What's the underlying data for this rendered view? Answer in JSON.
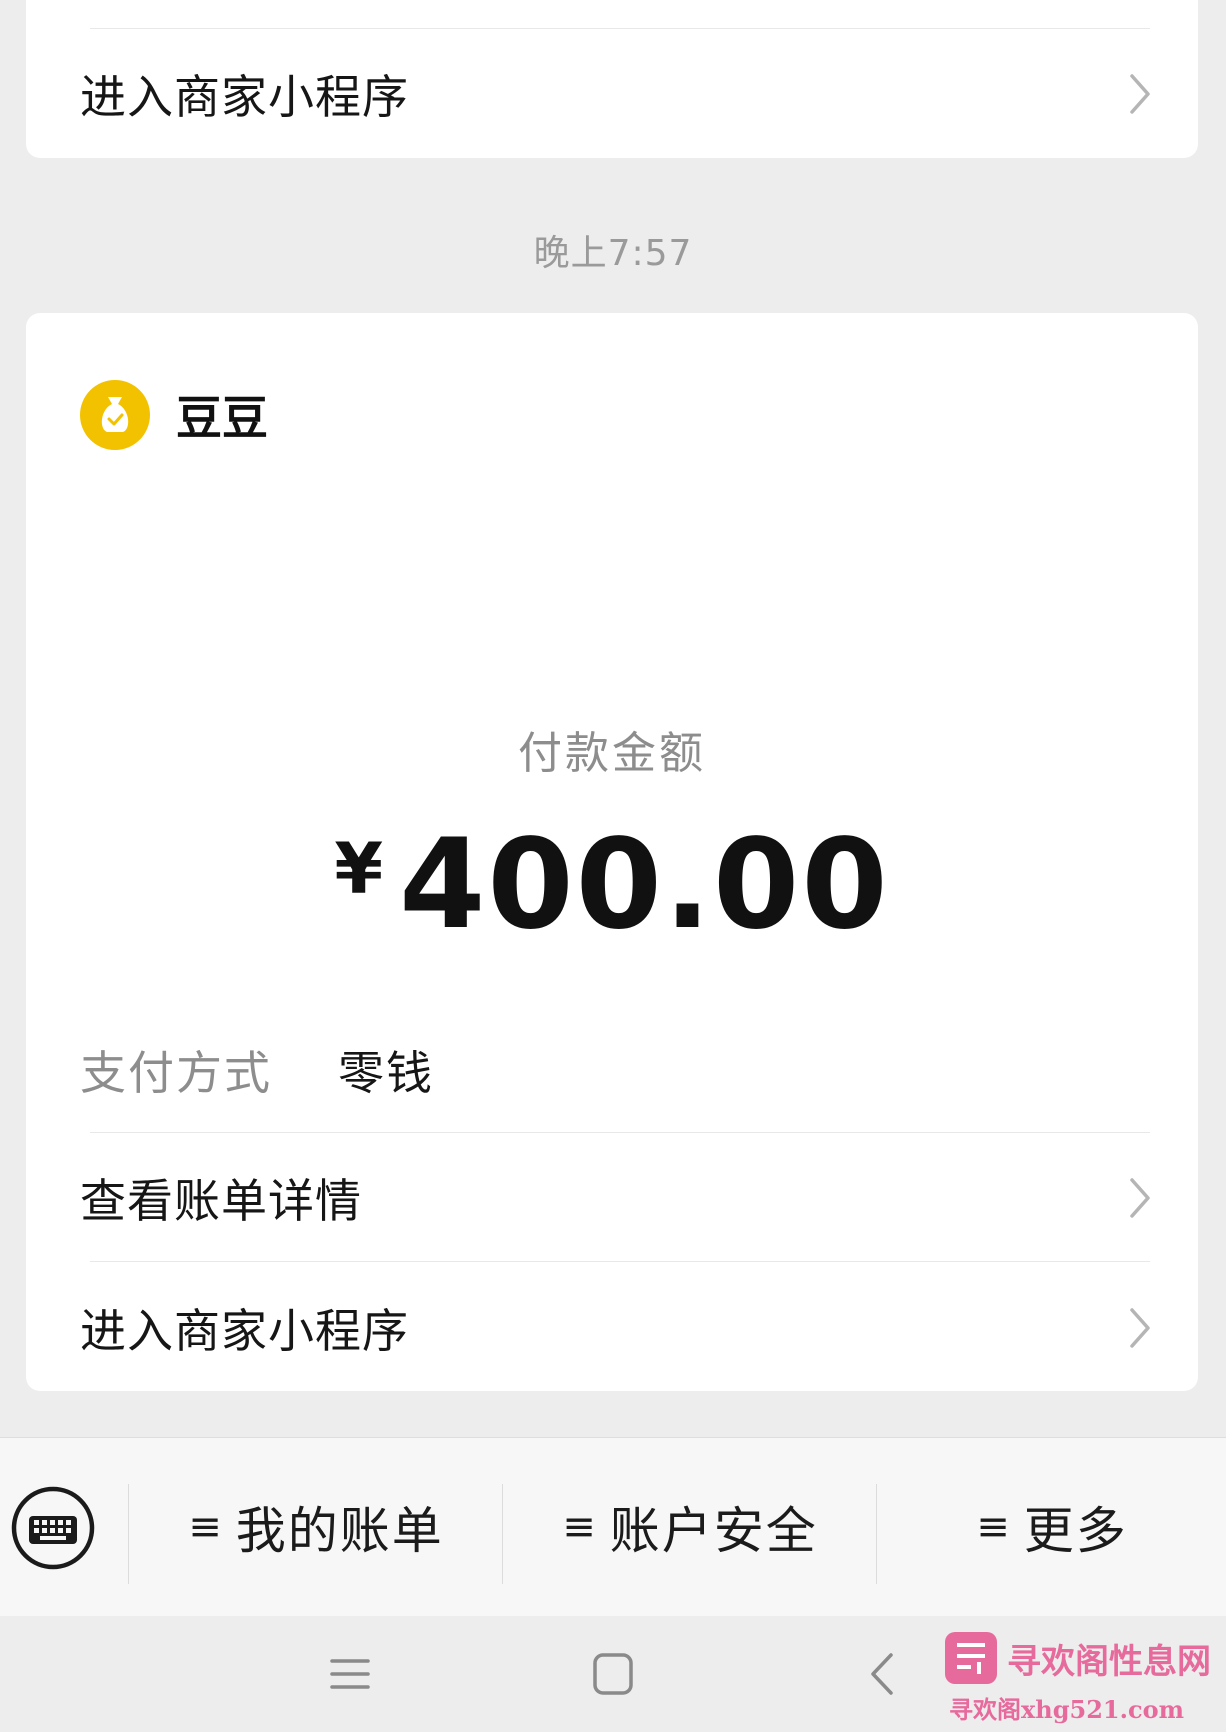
{
  "previous_message": {
    "enter_mini_program_label": "进入商家小程序"
  },
  "timestamp": "晚上7:57",
  "payment_card": {
    "merchant_name": "豆豆",
    "amount_label": "付款金额",
    "currency_symbol": "¥",
    "amount": "400.00",
    "payment_method_label": "支付方式",
    "payment_method_value": "零钱",
    "view_bill_details_label": "查看账单详情",
    "enter_mini_program_label": "进入商家小程序"
  },
  "bottom_menu": {
    "items": [
      {
        "icon": "menu-lines-icon",
        "label": "我的账单"
      },
      {
        "icon": "menu-lines-icon",
        "label": "账户安全"
      },
      {
        "icon": "menu-lines-icon",
        "label": "更多"
      }
    ],
    "menu_glyph": "≡"
  },
  "watermark": {
    "text": "寻欢阁性息网",
    "url": "寻欢阁xhg521.com"
  },
  "colors": {
    "background": "#ededed",
    "card": "#ffffff",
    "merchant_avatar": "#f2c200",
    "secondary_text": "#8d8d8d",
    "primary_text": "#111111",
    "watermark": "#e76a9c"
  }
}
